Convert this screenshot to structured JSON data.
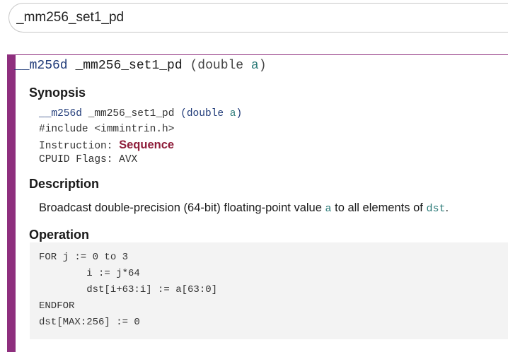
{
  "search": {
    "value": "_mm256_set1_pd"
  },
  "signature": {
    "return_type": "__m256d",
    "name": "_mm256_set1_pd",
    "open_paren": "(",
    "arg_type": "double",
    "arg_name": "a",
    "close_paren": ")"
  },
  "synopsis": {
    "heading": "Synopsis",
    "return_type": "__m256d",
    "name": "_mm256_set1_pd",
    "arg_type": "(double",
    "arg_name": "a",
    "close_paren": ")",
    "include": "#include <immintrin.h>",
    "instruction_label": "Instruction:",
    "instruction_value": "Sequence",
    "cpuid_label": "CPUID Flags:",
    "cpuid_value": "AVX"
  },
  "description": {
    "heading": "Description",
    "text_before": "Broadcast double-precision (64-bit) floating-point value",
    "code_a": "a",
    "text_middle": "to all elements of",
    "code_dst": "dst",
    "text_after": "."
  },
  "operation": {
    "heading": "Operation",
    "lines": [
      "FOR j := 0 to 3",
      "\ti := j*64",
      "\tdst[i+63:i] := a[63:0]",
      "ENDFOR",
      "dst[MAX:256] := 0"
    ]
  }
}
